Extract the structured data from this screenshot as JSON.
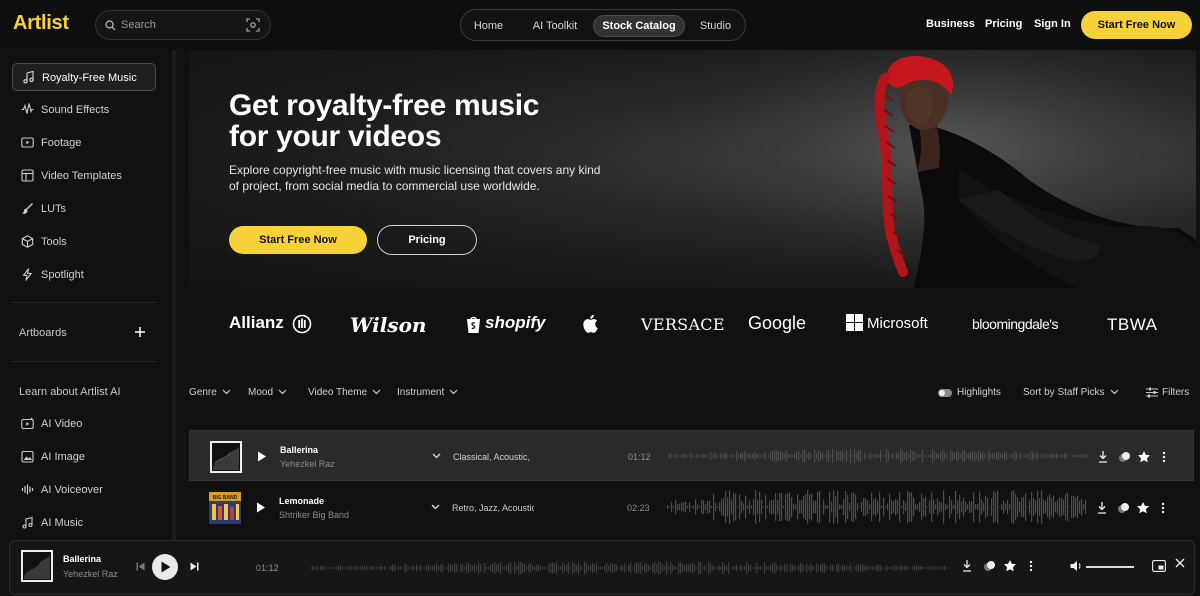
{
  "header": {
    "logo": "Artlist",
    "search_placeholder": "Search",
    "nav_tabs": [
      "Home",
      "AI Toolkit",
      "Stock Catalog",
      "Studio"
    ],
    "active_tab": "Stock Catalog",
    "right_links": [
      "Business",
      "Pricing",
      "Sign In"
    ],
    "cta": "Start Free Now"
  },
  "sidebar": {
    "items": [
      {
        "label": "Royalty-Free Music",
        "icon": "music-note-icon",
        "active": true
      },
      {
        "label": "Sound Effects",
        "icon": "waveform-icon"
      },
      {
        "label": "Footage",
        "icon": "video-play-icon"
      },
      {
        "label": "Video Templates",
        "icon": "template-icon"
      },
      {
        "label": "LUTs",
        "icon": "brush-icon"
      },
      {
        "label": "Tools",
        "icon": "cube-icon"
      },
      {
        "label": "Spotlight",
        "icon": "lightning-icon"
      }
    ],
    "artboards_label": "Artboards",
    "ai_heading": "Learn about Artlist AI",
    "ai_items": [
      {
        "label": "AI Video",
        "icon": "ai-video-icon"
      },
      {
        "label": "AI Image",
        "icon": "ai-image-icon"
      },
      {
        "label": "AI Voiceover",
        "icon": "ai-voiceover-icon"
      },
      {
        "label": "AI Music",
        "icon": "ai-music-icon"
      }
    ]
  },
  "hero": {
    "title_line1": "Get royalty-free music",
    "title_line2": "for your videos",
    "subtitle": "Explore copyright-free music with music licensing that covers any kind of project, from social media to commercial use worldwide.",
    "primary_button": "Start Free Now",
    "secondary_button": "Pricing"
  },
  "brands": [
    "Allianz",
    "Wilson",
    "shopify",
    "Apple",
    "VERSACE",
    "Google",
    "Microsoft",
    "bloomingdale's",
    "TBWA"
  ],
  "filters": {
    "left": [
      "Genre",
      "Mood",
      "Video Theme",
      "Instrument"
    ],
    "highlights_label": "Highlights",
    "sort_label": "Sort by Staff Picks",
    "filters_label": "Filters"
  },
  "tracks": [
    {
      "title": "Ballerina",
      "artist": "Yehezkel Raz",
      "tags": "Classical, Acoustic,",
      "duration": "01:12",
      "selected": true
    },
    {
      "title": "Lemonade",
      "artist": "Shtriker Big Band",
      "tags": "Retro, Jazz, Acoustic",
      "duration": "02:23",
      "selected": false
    }
  ],
  "player": {
    "title": "Ballerina",
    "artist": "Yehezkel Raz",
    "time": "01:12"
  },
  "colors": {
    "accent": "#f7d138",
    "background": "#111111",
    "selected_row": "#2a2a2a"
  }
}
